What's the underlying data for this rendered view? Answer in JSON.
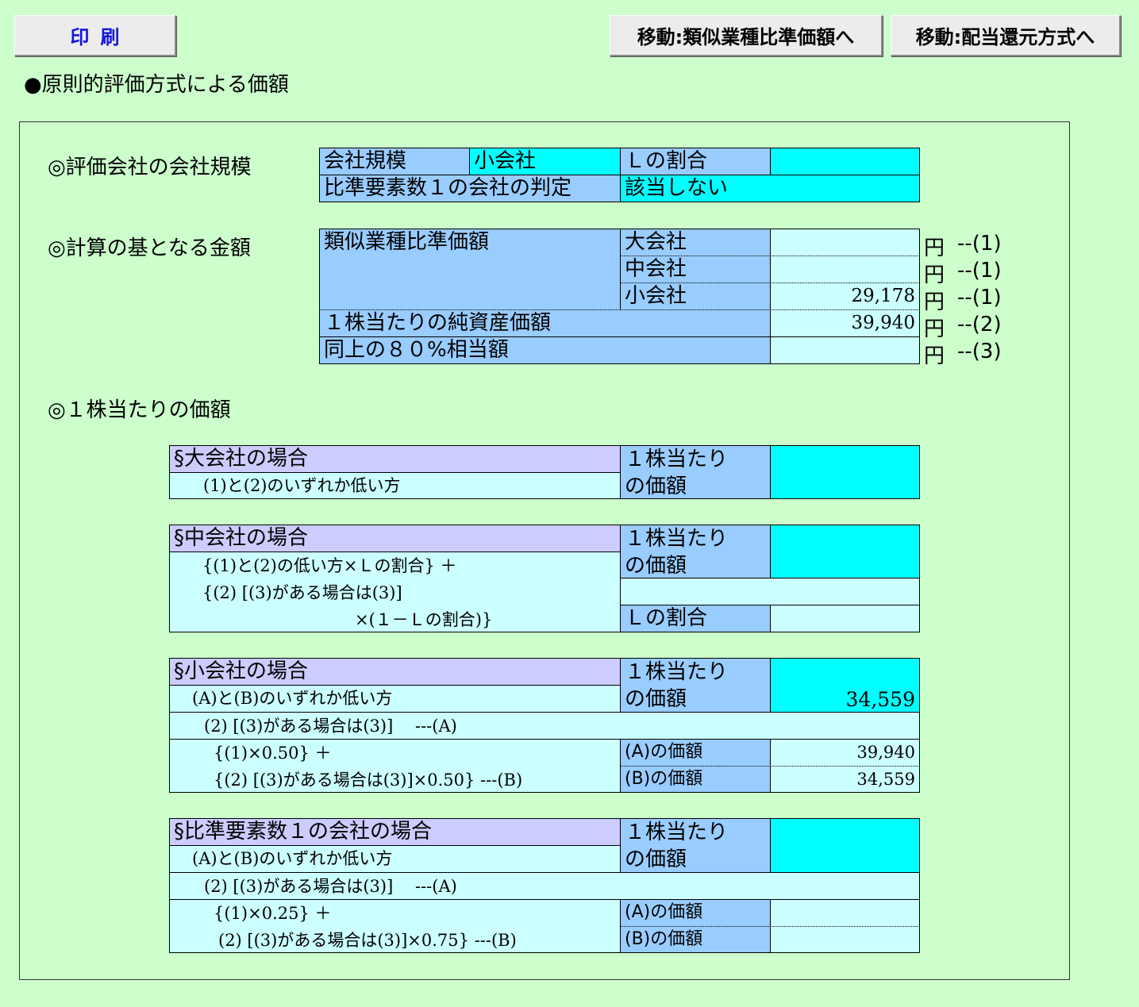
{
  "toolbar": {
    "print_label": "印刷",
    "nav1_label": "移動:類似業種比準価額へ",
    "nav2_label": "移動:配当還元方式へ"
  },
  "page_title": "●原則的評価方式による価額",
  "section1": {
    "heading": "◎評価会社の会社規模",
    "size_label": "会社規模",
    "size_value": "小会社",
    "l_ratio_label": "Ｌの割合",
    "l_ratio_value": "",
    "one_factor_label": "比準要素数１の会社の判定",
    "one_factor_value": "該当しない"
  },
  "section2": {
    "heading": "◎計算の基となる金額",
    "similar_label": "類似業種比準価額",
    "rows": [
      {
        "label": "大会社",
        "value": "",
        "unit": "円",
        "ref": "--(1)"
      },
      {
        "label": "中会社",
        "value": "",
        "unit": "円",
        "ref": "--(1)"
      },
      {
        "label": "小会社",
        "value": "29,178",
        "unit": "円",
        "ref": "--(1)"
      }
    ],
    "net_asset_label": "１株当たりの純資産価額",
    "net_asset_value": "39,940",
    "net_asset_unit": "円",
    "net_asset_ref": "--(2)",
    "eighty_label": "同上の８０%相当額",
    "eighty_value": "",
    "eighty_unit": "円",
    "eighty_ref": "--(3)"
  },
  "section3": {
    "heading": "◎１株当たりの価額",
    "per_share_line1": "１株当たり",
    "per_share_line2": "の価額",
    "large": {
      "title": "§大会社の場合",
      "formula": "(1)と(2)のいずれか低い方",
      "value": ""
    },
    "medium": {
      "title": "§中会社の場合",
      "formula1": "{(1)と(2)の低い方×Ｌの割合} ＋",
      "formula2": "{(2) [(3)がある場合は(3)]",
      "formula3": "×(１－Ｌの割合)}",
      "value": "",
      "l_ratio_label": "Ｌの割合",
      "l_ratio_value": ""
    },
    "small": {
      "title": "§小会社の場合",
      "formula0": "(A)と(B)のいずれか低い方",
      "formula1": "(2) [(3)がある場合は(3)]　 ---(A)",
      "formula2": "{(1)×0.50} ＋",
      "formula3": "{(2) [(3)がある場合は(3)]×0.50} ---(B)",
      "value": "34,559",
      "a_label": "(A)の価額",
      "a_value": "39,940",
      "b_label": "(B)の価額",
      "b_value": "34,559"
    },
    "one_factor": {
      "title": "§比準要素数１の会社の場合",
      "formula0": "(A)と(B)のいずれか低い方",
      "formula1": "(2) [(3)がある場合は(3)]　 ---(A)",
      "formula2": "{(1)×0.25} ＋",
      "formula3": "(2) [(3)がある場合は(3)]×0.75} ---(B)",
      "value": "",
      "a_label": "(A)の価額",
      "a_value": "",
      "b_label": "(B)の価額",
      "b_value": ""
    }
  }
}
